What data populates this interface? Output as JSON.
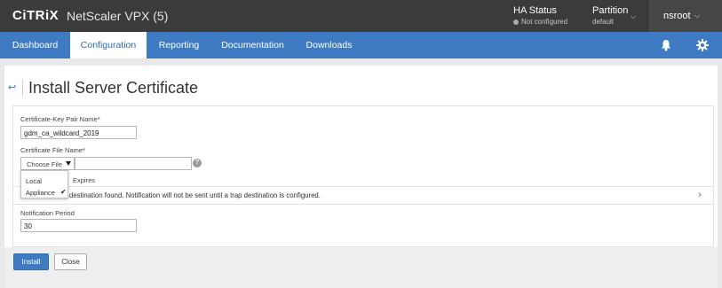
{
  "header": {
    "logo": "CiTRiX",
    "app_title": "NetScaler VPX (5)",
    "ha_status": {
      "label": "HA Status",
      "value": "Not configured"
    },
    "partition": {
      "label": "Partition",
      "value": "default"
    },
    "user": "nsroot"
  },
  "nav": {
    "tabs": [
      {
        "label": "Dashboard"
      },
      {
        "label": "Configuration"
      },
      {
        "label": "Reporting"
      },
      {
        "label": "Documentation"
      },
      {
        "label": "Downloads"
      }
    ],
    "active_tab": "Configuration"
  },
  "page": {
    "back_symbol": "↩",
    "title": "Install Server Certificate"
  },
  "form": {
    "keypair_label": "Certificate-Key Pair Name*",
    "keypair_value": "gdm_ca_wildcard_2019",
    "certfile_label": "Certificate File Name*",
    "choose_file_label": "Choose File",
    "certfile_value": "",
    "help_symbol": "?",
    "dropdown_options": [
      "Local",
      "Appliance"
    ],
    "dropdown_selected": "Appliance",
    "expires_label": "Expires",
    "notice_bold": "No",
    "notice_text": "SNMP Trap destination found. Notification will not be sent until a trap destination is configured.",
    "notification_period_label": "Notification Period",
    "notification_period_value": "30"
  },
  "buttons": {
    "install": "Install",
    "close": "Close"
  },
  "colors": {
    "topbar": "#3b3b3b",
    "nav": "#3f7bc2",
    "accent": "#2f6cb3"
  }
}
